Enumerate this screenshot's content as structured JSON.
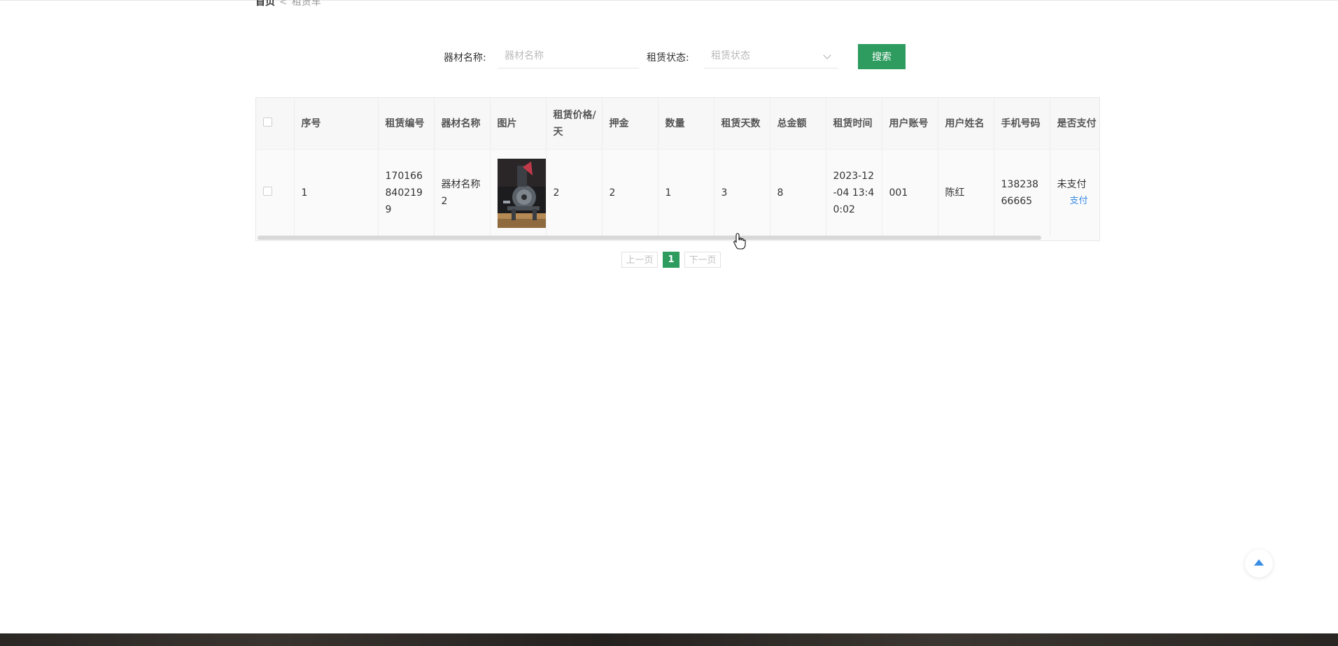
{
  "breadcrumb": {
    "home": "首页",
    "separator": "<",
    "current": "租赁车"
  },
  "search": {
    "name_label": "器材名称:",
    "name_placeholder": "器材名称",
    "name_value": "",
    "status_label": "租赁状态:",
    "status_placeholder": "租赁状态",
    "button_label": "搜索"
  },
  "table": {
    "headers": [
      "序号",
      "租赁编号",
      "器材名称",
      "图片",
      "租赁价格/天",
      "押金",
      "数量",
      "租赁天数",
      "总金额",
      "租赁时间",
      "用户账号",
      "用户姓名",
      "手机号码",
      "是否支付"
    ],
    "rows": [
      {
        "index": "1",
        "rental_no": "1701668402199",
        "equipment_name": "器材名称2",
        "image_alt": "equipment photo",
        "price_per_day": "2",
        "deposit": "2",
        "quantity": "1",
        "days": "3",
        "total": "8",
        "rental_time": "2023-12-04 13:40:02",
        "account": "001",
        "user_name": "陈红",
        "phone": "13823866665",
        "pay_status": "未支付",
        "pay_action": "支付"
      }
    ]
  },
  "pagination": {
    "prev_label": "上一页",
    "current_page": "1",
    "next_label": "下一页"
  },
  "colors": {
    "primary_green": "#2e9b5f",
    "link_blue": "#3a8ee6"
  },
  "icons": {
    "back_to_top": "chevron-up-icon",
    "select_arrow": "chevron-down-icon"
  }
}
